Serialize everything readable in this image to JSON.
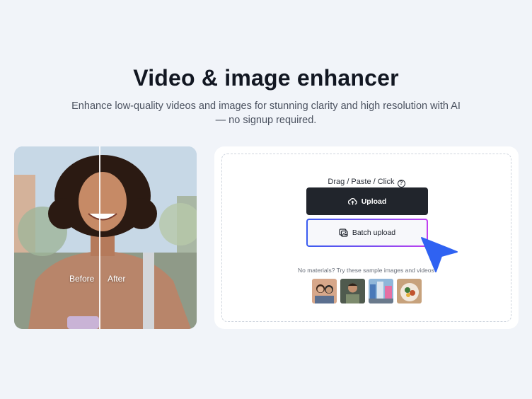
{
  "hero": {
    "title": "Video & image enhancer",
    "subtitle": "Enhance low-quality videos and images for stunning clarity and high resolution with AI — no signup required."
  },
  "preview": {
    "before_label": "Before",
    "after_label": "After"
  },
  "uploader": {
    "hint": "Drag / Paste / Click",
    "help_icon": "?",
    "upload_label": "Upload",
    "batch_label": "Batch upload",
    "samples_text": "No materials? Try these sample images and videos",
    "samples": [
      {
        "name": "sample-two-people"
      },
      {
        "name": "sample-man-portrait"
      },
      {
        "name": "sample-city-street"
      },
      {
        "name": "sample-food-plate"
      }
    ]
  },
  "colors": {
    "background": "#f1f4f9",
    "upload_button": "#21252c",
    "gradient_start": "#3a5cf0",
    "gradient_end": "#c040f0",
    "cursor": "#2f62f2"
  }
}
